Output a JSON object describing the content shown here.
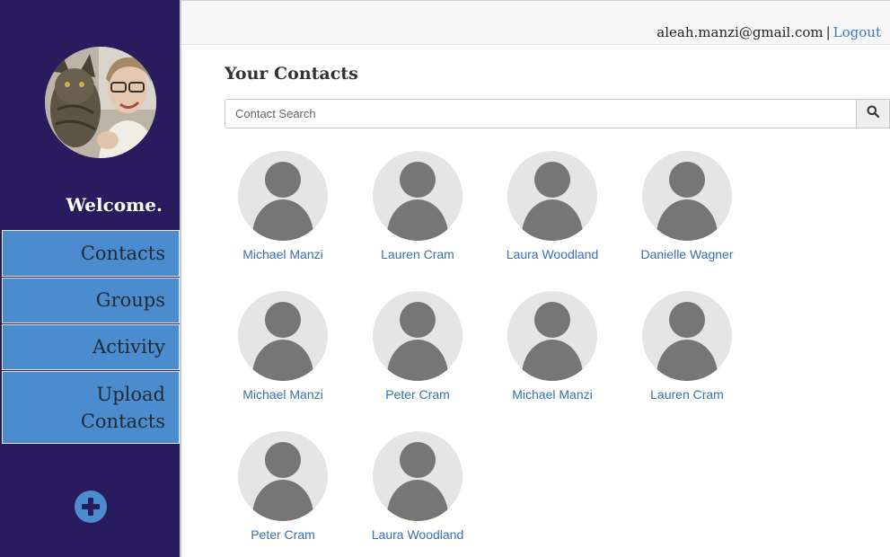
{
  "user": {
    "email": "aleah.manzi@gmail.com",
    "separator": "|",
    "logout_label": "Logout"
  },
  "sidebar": {
    "welcome": "Welcome.",
    "items": [
      {
        "label": "Contacts"
      },
      {
        "label": "Groups"
      },
      {
        "label": "Activity"
      },
      {
        "label_line1": "Upload",
        "label_line2": "Contacts"
      }
    ]
  },
  "main": {
    "title": "Your Contacts",
    "search": {
      "placeholder": "Contact Search",
      "value": ""
    },
    "contacts": [
      {
        "name": "Michael Manzi"
      },
      {
        "name": "Lauren Cram"
      },
      {
        "name": "Laura Woodland"
      },
      {
        "name": "Danielle Wagner"
      },
      {
        "name": "Michael Manzi"
      },
      {
        "name": "Peter Cram"
      },
      {
        "name": "Michael Manzi"
      },
      {
        "name": "Lauren Cram"
      },
      {
        "name": "Peter Cram"
      },
      {
        "name": "Laura Woodland"
      }
    ]
  },
  "colors": {
    "sidebar_bg": "#281c5e",
    "nav_bg": "#4a8ccd",
    "link": "#3a6fb0",
    "avatar_placeholder": "#767676"
  },
  "icons": {
    "search": "search-icon",
    "add": "plus-circle-icon",
    "profile": "profile-photo",
    "contact_avatar": "person-silhouette-icon"
  }
}
